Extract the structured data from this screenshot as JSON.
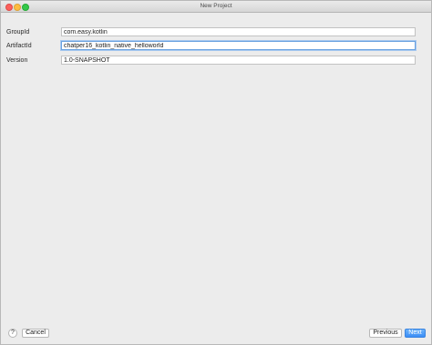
{
  "window": {
    "title": "New Project"
  },
  "form": {
    "group_id": {
      "label": "GroupId",
      "value": "com.easy.kotlin"
    },
    "artifact_id": {
      "label": "ArtifactId",
      "value": "chatper16_kotlin_native_helloworld"
    },
    "version": {
      "label": "Version",
      "value": "1.0-SNAPSHOT"
    }
  },
  "footer": {
    "help_label": "?",
    "cancel_label": "Cancel",
    "previous_label": "Previous",
    "next_label": "Next"
  },
  "colors": {
    "accent": "#3a8df6",
    "focus_ring": "#6aa2e0",
    "close_light": "#fc605c",
    "minimize_light": "#fdbc40",
    "maximize_light": "#34c84a"
  }
}
